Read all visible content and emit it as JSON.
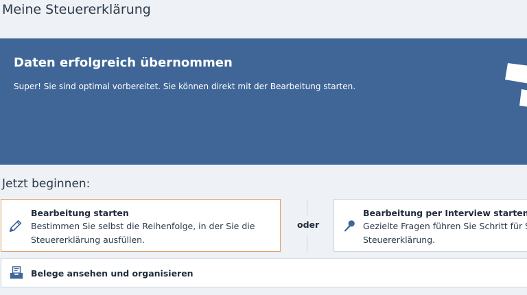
{
  "header": {
    "title": "Meine Steuererklärung"
  },
  "banner": {
    "title": "Daten erfolgreich übernommen",
    "subtitle": "Super! Sie sind optimal vorbereitet. Sie können direkt mit der Bearbeitung starten.",
    "background_color": "#3f6696"
  },
  "start_section": {
    "title": "Jetzt beginnen:",
    "option_manual": {
      "title": "Bearbeitung starten",
      "desc_line1": "Bestimmen Sie selbst die Reihenfolge, in der Sie die",
      "desc_line2": "Steuererklärung ausfüllen.",
      "icon": "pencil-icon"
    },
    "or_label": "oder",
    "option_interview": {
      "title": "Bearbeitung per Interview starten",
      "desc_line1": "Gezielte Fragen führen Sie Schritt für Schritt durch die",
      "desc_line2": "Steuererklärung.",
      "icon": "microphone-icon"
    },
    "receipts": {
      "title": "Belege ansehen und organisieren",
      "icon": "receipt-inbox-icon"
    }
  }
}
